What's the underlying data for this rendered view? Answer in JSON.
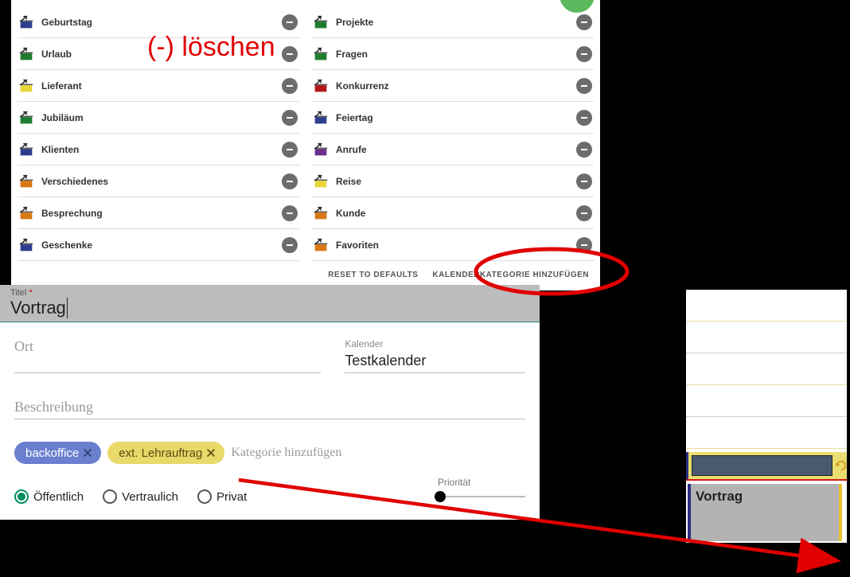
{
  "annotation": {
    "delete_label": "(-) löschen"
  },
  "categories_left": [
    {
      "label": "Geburtstag",
      "color": "#2e3e8e"
    },
    {
      "label": "Urlaub",
      "color": "#1e7c2e"
    },
    {
      "label": "Lieferant",
      "color": "#e8d63a"
    },
    {
      "label": "Jubiläum",
      "color": "#1e7c2e"
    },
    {
      "label": "Klienten",
      "color": "#2e3e8e"
    },
    {
      "label": "Verschiedenes",
      "color": "#d87814"
    },
    {
      "label": "Besprechung",
      "color": "#d87814"
    },
    {
      "label": "Geschenke",
      "color": "#2e3e8e"
    }
  ],
  "categories_right": [
    {
      "label": "Projekte",
      "color": "#1e7c2e"
    },
    {
      "label": "Fragen",
      "color": "#1e7c2e"
    },
    {
      "label": "Konkurrenz",
      "color": "#b01818"
    },
    {
      "label": "Feiertag",
      "color": "#2e3e8e"
    },
    {
      "label": "Anrufe",
      "color": "#6d2f8e"
    },
    {
      "label": "Reise",
      "color": "#e8d63a"
    },
    {
      "label": "Kunde",
      "color": "#d87814"
    },
    {
      "label": "Favoriten",
      "color": "#d87814"
    }
  ],
  "cat_actions": {
    "reset": "RESET TO DEFAULTS",
    "add": "KALENDERKATEGORIE HINZUFÜGEN"
  },
  "form": {
    "title_label": "Titel",
    "title_value": "Vortrag",
    "location_label": "Ort",
    "calendar_label": "Kalender",
    "calendar_value": "Testkalender",
    "description_label": "Beschreibung",
    "tag_blue": "backoffice",
    "tag_yellow": "ext. Lehrauftrag",
    "tag_add_placeholder": "Kategorie hinzufügen",
    "radio_public": "Öffentlich",
    "radio_confidential": "Vertraulich",
    "radio_private": "Privat",
    "priority_label": "Priorität"
  },
  "right_strip": {
    "vortrag_label": "Vortrag"
  }
}
